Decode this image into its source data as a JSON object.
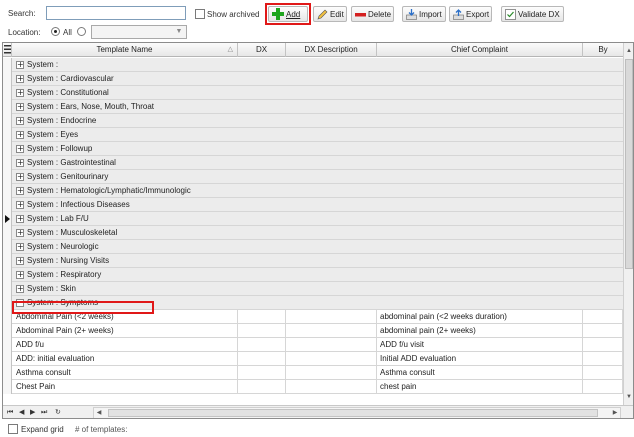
{
  "toolbar": {
    "search_label": "Search:",
    "show_archived_label": "Show archived",
    "location_label": "Location:",
    "all_label": "All",
    "add_label": "Add",
    "edit_label": "Edit",
    "delete_label": "Delete",
    "import_label": "Import",
    "export_label": "Export",
    "validate_dx_label": "Validate DX"
  },
  "grid": {
    "columns": {
      "template_name": "Template Name",
      "dx": "DX",
      "dx_description": "DX Description",
      "chief_complaint": "Chief Complaint",
      "by": "By"
    },
    "groups": [
      {
        "label": "System :",
        "expanded": false
      },
      {
        "label": "System : Cardiovascular",
        "expanded": false
      },
      {
        "label": "System : Constitutional",
        "expanded": false
      },
      {
        "label": "System : Ears, Nose, Mouth, Throat",
        "expanded": false
      },
      {
        "label": "System : Endocrine",
        "expanded": false
      },
      {
        "label": "System : Eyes",
        "expanded": false
      },
      {
        "label": "System : Followup",
        "expanded": false
      },
      {
        "label": "System : Gastrointestinal",
        "expanded": false
      },
      {
        "label": "System : Genitourinary",
        "expanded": false
      },
      {
        "label": "System : Hematologic/Lymphatic/Immunologic",
        "expanded": false
      },
      {
        "label": "System : Infectious Diseases",
        "expanded": false
      },
      {
        "label": "System : Lab F/U",
        "expanded": false
      },
      {
        "label": "System : Musculoskeletal",
        "expanded": false
      },
      {
        "label": "System : Neurologic",
        "expanded": false
      },
      {
        "label": "System : Nursing Visits",
        "expanded": false
      },
      {
        "label": "System : Respiratory",
        "expanded": false
      },
      {
        "label": "System : Skin",
        "expanded": false
      },
      {
        "label": "System : Symptoms",
        "expanded": true
      }
    ],
    "rows": [
      {
        "template_name": "Abdominal Pain (<2 weeks)",
        "dx": "",
        "dx_description": "",
        "chief_complaint": "abdominal pain (<2 weeks duration)",
        "by": ""
      },
      {
        "template_name": "Abdominal Pain (2+ weeks)",
        "dx": "",
        "dx_description": "",
        "chief_complaint": "abdominal pain (2+ weeks)",
        "by": ""
      },
      {
        "template_name": "ADD f/u",
        "dx": "",
        "dx_description": "",
        "chief_complaint": "ADD f/u visit",
        "by": ""
      },
      {
        "template_name": "ADD: initial evaluation",
        "dx": "",
        "dx_description": "",
        "chief_complaint": "Initial ADD evaluation",
        "by": ""
      },
      {
        "template_name": "Asthma consult",
        "dx": "",
        "dx_description": "",
        "chief_complaint": "Asthma consult",
        "by": ""
      },
      {
        "template_name": "Chest Pain",
        "dx": "",
        "dx_description": "",
        "chief_complaint": "chest pain",
        "by": ""
      }
    ]
  },
  "footer": {
    "expand_grid_label": "Expand grid",
    "template_count_label": "# of templates:"
  },
  "colors": {
    "highlight": "#e01818",
    "group_row_bg": "#ececec",
    "add_icon": "#1ea51e",
    "delete_icon": "#d42020"
  }
}
